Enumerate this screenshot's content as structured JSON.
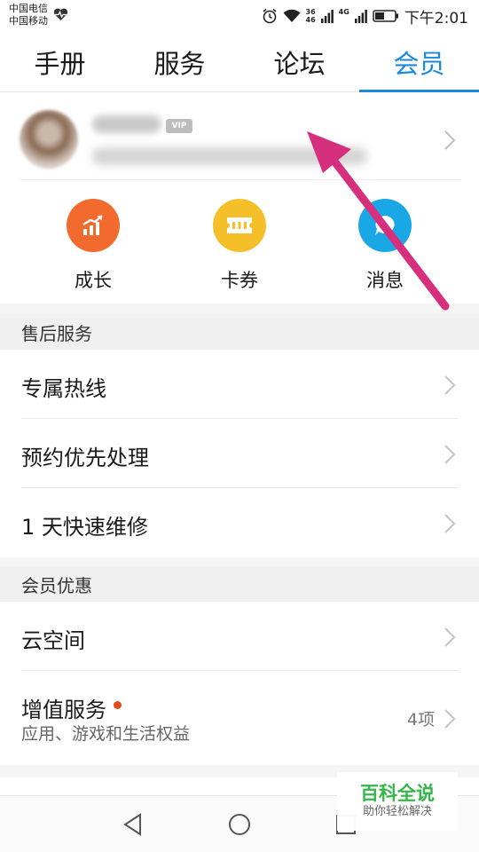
{
  "status_bar": {
    "carrier_1": "中国电信",
    "carrier_2": "中国移动",
    "net_1": "36",
    "net_2": "46",
    "net_3": "4G",
    "time": "下午2:01"
  },
  "tabs": [
    {
      "label": "手册",
      "active": false
    },
    {
      "label": "服务",
      "active": false
    },
    {
      "label": "论坛",
      "active": false
    },
    {
      "label": "会员",
      "active": true
    }
  ],
  "profile": {
    "vip_badge": "VIP"
  },
  "quick_actions": [
    {
      "label": "成长",
      "icon": "growth-chart-icon",
      "color": "#f26a2e"
    },
    {
      "label": "卡券",
      "icon": "ticket-icon",
      "color": "#f5bf2a"
    },
    {
      "label": "消息",
      "icon": "message-bubble-icon",
      "color": "#1aa7e6"
    }
  ],
  "sections": {
    "after_sales": {
      "title": "售后服务",
      "items": [
        {
          "label": "专属热线"
        },
        {
          "label": "预约优先处理"
        },
        {
          "label": "1 天快速维修"
        }
      ]
    },
    "member_benefits": {
      "title": "会员优惠",
      "items": [
        {
          "label": "云空间"
        },
        {
          "label": "增值服务",
          "subtitle": "应用、游戏和生活权益",
          "count": "4项",
          "has_dot": true
        }
      ]
    }
  },
  "watermark": {
    "title": "百科全说",
    "subtitle": "助你轻松解决"
  },
  "colors": {
    "accent": "#1a8ad9",
    "annotation": "#d62f7e"
  }
}
